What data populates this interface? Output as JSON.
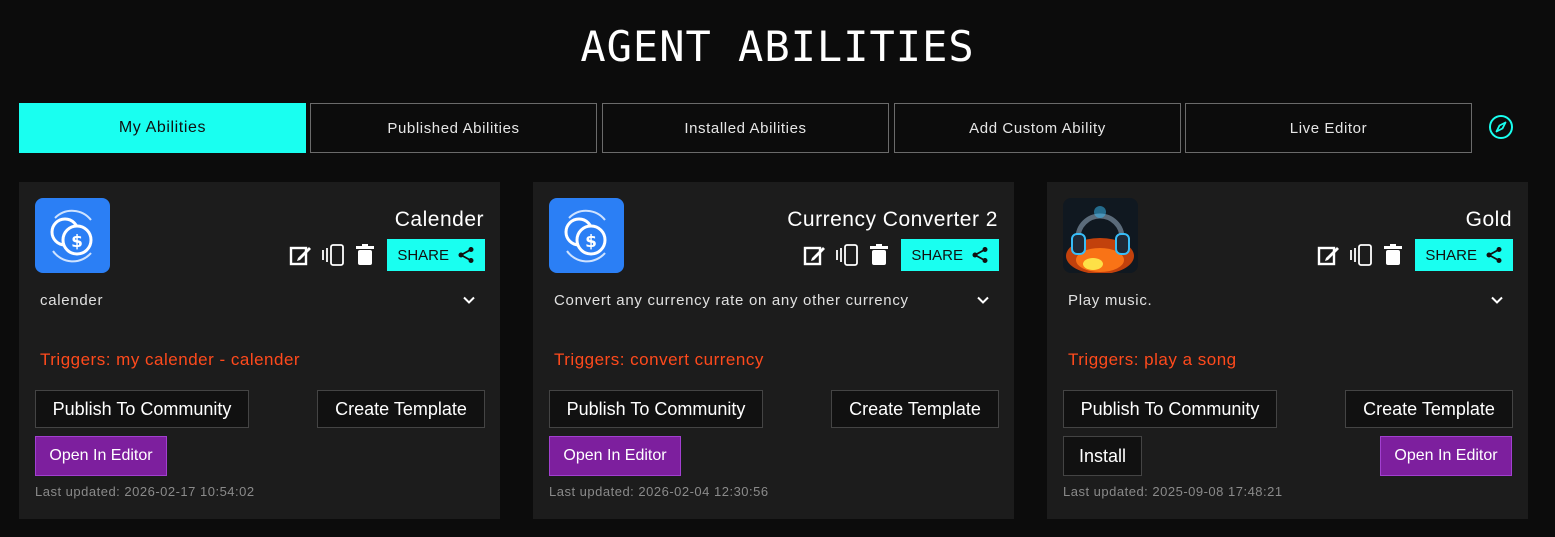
{
  "page": {
    "title": "AGENT ABILITIES"
  },
  "tabs": [
    {
      "label": "My Abilities"
    },
    {
      "label": "Published Abilities"
    },
    {
      "label": "Installed Abilities"
    },
    {
      "label": "Add Custom Ability"
    },
    {
      "label": "Live Editor"
    }
  ],
  "explore_icon": "compass-icon",
  "colors": {
    "accent": "#19fff0",
    "trigger": "#ff4a1c",
    "editor_button": "#7d1f9e",
    "card_bg": "#1c1c1c"
  },
  "cards": [
    {
      "title": "Calender",
      "icon": "currency-exchange-icon",
      "share_label": "SHARE",
      "description": "calender",
      "triggers": "Triggers: my calender - calender",
      "publish_label": "Publish To Community",
      "template_label": "Create Template",
      "editor_label": "Open In Editor",
      "updated": "Last updated: 2026-02-17 10:54:02"
    },
    {
      "title": "Currency Converter 2",
      "icon": "currency-exchange-icon",
      "share_label": "SHARE",
      "description": "Convert any currency rate on any other currency",
      "triggers": "Triggers: convert currency",
      "publish_label": "Publish To Community",
      "template_label": "Create Template",
      "editor_label": "Open In Editor",
      "updated": "Last updated: 2026-02-04 12:30:56"
    },
    {
      "title": "Gold",
      "icon": "music-headphones-image",
      "share_label": "SHARE",
      "description": "Play music.",
      "triggers": "Triggers: play a song",
      "publish_label": "Publish To Community",
      "template_label": "Create Template",
      "install_label": "Install",
      "editor_label": "Open In Editor",
      "updated": "Last updated: 2025-09-08 17:48:21"
    }
  ]
}
